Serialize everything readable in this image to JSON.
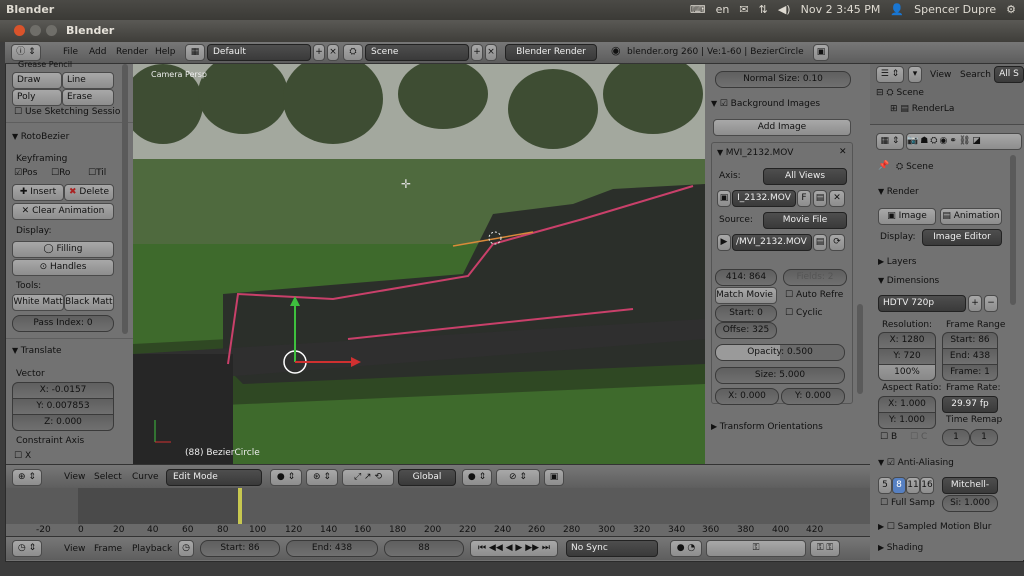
{
  "system_bar": {
    "app": "Blender",
    "lang": "en",
    "datetime": "Nov 2  3:45 PM",
    "user": "Spencer Dupre"
  },
  "window": {
    "title": "Blender"
  },
  "info_header": {
    "menus": [
      "File",
      "Add",
      "Render",
      "Help"
    ],
    "screen": "Default",
    "scene": "Scene",
    "engine": "Blender Render",
    "stats": "blender.org 260 | Ve:1-60 | BezierCircle"
  },
  "tool_shelf": {
    "grease_pencil": "Grease Pencil",
    "draw": "Draw",
    "line": "Line",
    "poly": "Poly",
    "erase": "Erase",
    "use_sketching": "Use Sketching Sessio",
    "rotobezier_title": "RotoBezier",
    "keyframing": "Keyframing",
    "key_pos": "Pos",
    "key_rot": "Ro",
    "key_tilt": "Til",
    "insert": "Insert",
    "delete": "Delete",
    "clear_anim": "Clear Animation",
    "display": "Display:",
    "filling": "Filling",
    "handles": "Handles",
    "tools": "Tools:",
    "white_matte": "White Matt",
    "black_matte": "Black Matte",
    "pass_index": "Pass Index: 0",
    "translate_title": "Translate",
    "vector": "Vector",
    "x": "X: -0.0157",
    "y": "Y: 0.007853",
    "z": "Z: 0.000",
    "constraint_axis": "Constraint Axis",
    "cx": "X"
  },
  "viewport": {
    "camera_label": "Camera Persp",
    "object_label": "(88) BezierCircle"
  },
  "properties_panel": {
    "normal_size": "Normal Size: 0.10",
    "bg_images": "Background Images",
    "add_image": "Add Image",
    "movie_name": "MVI_2132.MOV",
    "axis_label": "Axis:",
    "axis_value": "All Views",
    "image_name": "I_2132.MOV",
    "f_btn": "F",
    "source_label": "Source:",
    "source_value": "Movie File",
    "filepath": "/MVI_2132.MOV",
    "res": "414: 864",
    "fields": "Fields: 2",
    "match_movie": "Match Movie L",
    "auto_refresh": "Auto Refre",
    "start": "Start: 0",
    "cyclic": "Cyclic",
    "offset": "Offse: 325",
    "opacity": "Opacity: 0.500",
    "size": "Size: 5.000",
    "px": "X: 0.000",
    "py": "Y: 0.000",
    "transform_orient": "Transform Orientations"
  },
  "view3d_header": {
    "menus": [
      "View",
      "Select",
      "Curve"
    ],
    "mode": "Edit Mode",
    "orientation": "Global"
  },
  "timeline": {
    "ticks": [
      "-20",
      "0",
      "20",
      "40",
      "60",
      "80",
      "100",
      "120",
      "140",
      "160",
      "180",
      "200",
      "220",
      "240",
      "260",
      "280",
      "300",
      "320",
      "340",
      "360",
      "380",
      "400",
      "420"
    ],
    "current_frame_marker": 88,
    "menus": [
      "View",
      "Frame",
      "Playback"
    ],
    "start": "Start: 86",
    "end": "End: 438",
    "frame": "88",
    "sync": "No Sync"
  },
  "outliner": {
    "view": "View",
    "search": "Search",
    "all_scenes": "All S",
    "scene": "Scene",
    "render_layers": "RenderLa"
  },
  "render_props": {
    "scene_label": "Scene",
    "render": "Render",
    "image_btn": "Image",
    "animation_btn": "Animation",
    "display_label": "Display:",
    "display_value": "Image Editor",
    "layers": "Layers",
    "dimensions": "Dimensions",
    "preset": "HDTV 720p",
    "resolution": "Resolution:",
    "res_x": "X: 1280",
    "res_y": "Y: 720",
    "res_pct": "100%",
    "frame_range": "Frame Range",
    "fr_start": "Start: 86",
    "fr_end": "End: 438",
    "fr_frame": "Frame: 1",
    "aspect_ratio": "Aspect Ratio:",
    "asp_x": "X: 1.000",
    "asp_y": "Y: 1.000",
    "frame_rate": "Frame Rate:",
    "fps": "29.97 fp",
    "time_remap": "Time Remap",
    "remap_old": "1",
    "remap_new": "1",
    "b": "B",
    "c": "C",
    "anti_aliasing": "Anti-Aliasing",
    "aa_5": "5",
    "aa_8": "8",
    "aa_11": "11",
    "aa_16": "16",
    "aa_filter": "Mitchell-",
    "full_sample": "Full Samp",
    "aa_size": "Si: 1.000",
    "motion_blur": "Sampled Motion Blur",
    "shading": "Shading"
  }
}
